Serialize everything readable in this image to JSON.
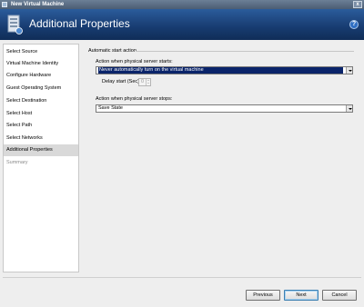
{
  "window": {
    "title": "New Virtual Machine",
    "close_label": "x"
  },
  "header": {
    "title": "Additional Properties",
    "help_label": "?"
  },
  "sidebar": {
    "items": [
      {
        "label": "Select Source",
        "state": "normal"
      },
      {
        "label": "Virtual Machine Identity",
        "state": "normal"
      },
      {
        "label": "Configure Hardware",
        "state": "normal"
      },
      {
        "label": "Guest Operating System",
        "state": "normal"
      },
      {
        "label": "Select Destination",
        "state": "normal"
      },
      {
        "label": "Select Host",
        "state": "normal"
      },
      {
        "label": "Select Path",
        "state": "normal"
      },
      {
        "label": "Select Networks",
        "state": "normal"
      },
      {
        "label": "Additional Properties",
        "state": "active"
      },
      {
        "label": "Summary",
        "state": "disabled"
      }
    ]
  },
  "main": {
    "group_label": "Automatic start action",
    "start_label": "Action when physical server starts:",
    "start_value": "Never automatically turn on the virtual machine",
    "delay_label": "Delay start (Sec):",
    "delay_value": "0",
    "stop_label": "Action when physical server stops:",
    "stop_value": "Save State"
  },
  "footer": {
    "previous_label": "Previous",
    "next_label": "Next",
    "cancel_label": "Cancel"
  },
  "colors": {
    "banner": "#173b70",
    "selection": "#0a246a",
    "active_nav": "#d9d9d9"
  }
}
